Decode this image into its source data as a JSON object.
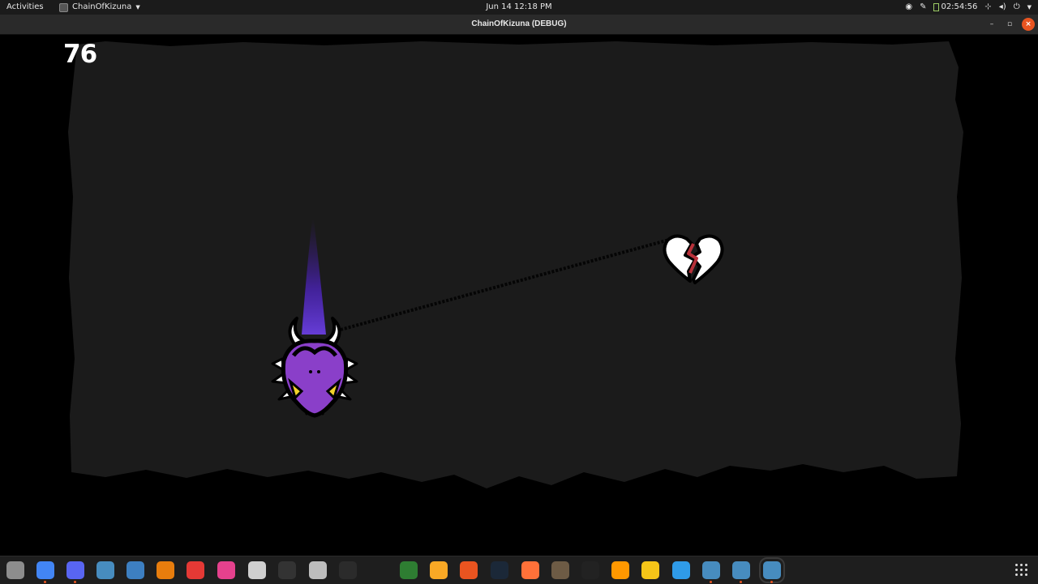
{
  "topbar": {
    "activities": "Activities",
    "app_name": "ChainOfKizuna",
    "clock": "Jun 14  12:18 PM",
    "timer": "02:54:56"
  },
  "window": {
    "title": "ChainOfKizuna (DEBUG)"
  },
  "game": {
    "score": "76"
  },
  "dock": {
    "apps": [
      {
        "name": "files",
        "color": "#8d8d8d"
      },
      {
        "name": "chrome",
        "color": "#4285f4",
        "running": true
      },
      {
        "name": "discord",
        "color": "#5865f2",
        "running": true
      },
      {
        "name": "godot",
        "color": "#478cbf"
      },
      {
        "name": "godot-alt",
        "color": "#3d7fc1"
      },
      {
        "name": "blender",
        "color": "#e87d0d"
      },
      {
        "name": "headphones",
        "color": "#e53935"
      },
      {
        "name": "krita",
        "color": "#e5418d"
      },
      {
        "name": "twitch",
        "color": "#cfcfcf"
      },
      {
        "name": "inkscape",
        "color": "#333333"
      },
      {
        "name": "screenshot",
        "color": "#bdbdbd"
      },
      {
        "name": "obs",
        "color": "#2b2b2b"
      },
      {
        "name": "audio",
        "color": "#2e7d32"
      },
      {
        "name": "rhythmbox",
        "color": "#f9a825"
      },
      {
        "name": "software",
        "color": "#e95420"
      },
      {
        "name": "steam",
        "color": "#1b2838"
      },
      {
        "name": "firefox",
        "color": "#ff7139"
      },
      {
        "name": "gimp",
        "color": "#6d5b45"
      },
      {
        "name": "unity",
        "color": "#222222"
      },
      {
        "name": "sublime",
        "color": "#ff9800"
      },
      {
        "name": "vscode",
        "color": "#f5c518"
      },
      {
        "name": "dotnet",
        "color": "#2f9be8"
      },
      {
        "name": "godot-1",
        "color": "#478cbf",
        "running": true
      },
      {
        "name": "godot-2",
        "color": "#478cbf",
        "running": true
      },
      {
        "name": "godot-3",
        "color": "#478cbf",
        "running": true
      }
    ]
  }
}
